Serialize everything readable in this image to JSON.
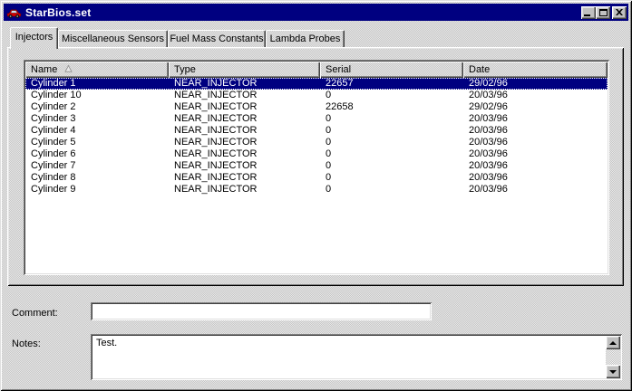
{
  "window": {
    "title": "StarBios.set"
  },
  "tabs": [
    {
      "label": "Injectors",
      "active": true
    },
    {
      "label": "Miscellaneous Sensors",
      "active": false
    },
    {
      "label": "Fuel Mass Constants",
      "active": false
    },
    {
      "label": "Lambda Probes",
      "active": false
    }
  ],
  "list": {
    "columns": [
      {
        "label": "Name",
        "sort": "asc"
      },
      {
        "label": "Type"
      },
      {
        "label": "Serial"
      },
      {
        "label": "Date"
      }
    ],
    "rows": [
      {
        "name": "Cylinder 1",
        "type": "NEAR_INJECTOR",
        "serial": "22657",
        "date": "29/02/96",
        "selected": true
      },
      {
        "name": "Cylinder 10",
        "type": "NEAR_INJECTOR",
        "serial": "0",
        "date": "20/03/96",
        "selected": false
      },
      {
        "name": "Cylinder 2",
        "type": "NEAR_INJECTOR",
        "serial": "22658",
        "date": "29/02/96",
        "selected": false
      },
      {
        "name": "Cylinder 3",
        "type": "NEAR_INJECTOR",
        "serial": "0",
        "date": "20/03/96",
        "selected": false
      },
      {
        "name": "Cylinder 4",
        "type": "NEAR_INJECTOR",
        "serial": "0",
        "date": "20/03/96",
        "selected": false
      },
      {
        "name": "Cylinder 5",
        "type": "NEAR_INJECTOR",
        "serial": "0",
        "date": "20/03/96",
        "selected": false
      },
      {
        "name": "Cylinder 6",
        "type": "NEAR_INJECTOR",
        "serial": "0",
        "date": "20/03/96",
        "selected": false
      },
      {
        "name": "Cylinder 7",
        "type": "NEAR_INJECTOR",
        "serial": "0",
        "date": "20/03/96",
        "selected": false
      },
      {
        "name": "Cylinder 8",
        "type": "NEAR_INJECTOR",
        "serial": "0",
        "date": "20/03/96",
        "selected": false
      },
      {
        "name": "Cylinder 9",
        "type": "NEAR_INJECTOR",
        "serial": "0",
        "date": "20/03/96",
        "selected": false
      }
    ]
  },
  "fields": {
    "comment": {
      "label": "Comment:",
      "value": ""
    },
    "notes": {
      "label": "Notes:",
      "value": "Test."
    }
  },
  "icons": {
    "titlebar": "car-icon",
    "window_controls": [
      "minimize-icon",
      "maximize-icon",
      "close-icon"
    ],
    "name_column": "sort-ascending-icon",
    "notes_scrollbar": [
      "scroll-up-icon",
      "scroll-down-icon"
    ]
  },
  "colors": {
    "titlebar_bg": "#000080",
    "titlebar_text": "#ffffff",
    "selection_bg": "#000080",
    "selection_text": "#ffffff",
    "face": "#c0c0c0"
  }
}
